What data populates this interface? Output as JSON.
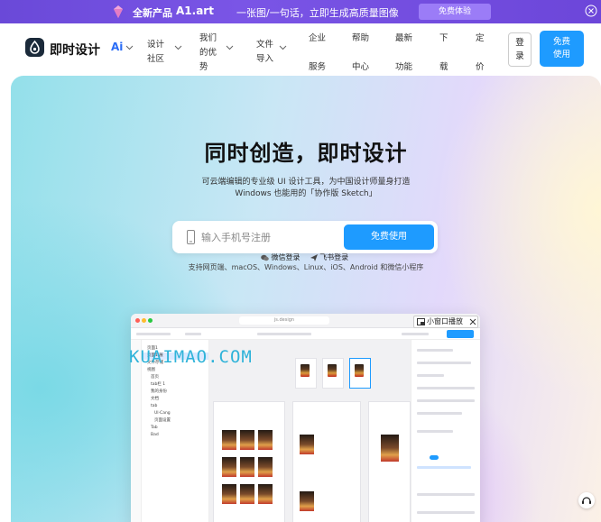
{
  "promo": {
    "label_new": "全新产品",
    "product": "A1.art",
    "tagline": "一张图/一句话，立即生成高质量图像",
    "cta": "免费体验",
    "icon": "gem-icon",
    "close_icon": "close-icon"
  },
  "nav": {
    "brand": "即时设计",
    "ai": "Ai",
    "items": [
      {
        "label": "设计\n社区",
        "has_dropdown": true
      },
      {
        "label": "我们\n的优\n势",
        "has_dropdown": true
      },
      {
        "label": "文件\n导入",
        "has_dropdown": true
      },
      {
        "label": "企业\n\n服务"
      },
      {
        "label": "帮助\n\n中心"
      },
      {
        "label": "最新\n\n功能"
      },
      {
        "label": "下\n\n载"
      },
      {
        "label": "定\n\n价"
      }
    ],
    "login": "登\n录",
    "signup": "免费\n使用"
  },
  "hero": {
    "title": "同时创造，即时设计",
    "subtitle_line1": "可云端编辑的专业级 UI 设计工具，为中国设计师量身打造",
    "subtitle_line2": "Windows 也能用的「协作版 Sketch」",
    "phone_placeholder": "输入手机号注册",
    "free_button": "免费使用",
    "wechat_login": "微信登录",
    "feishu_login": "飞书登录",
    "platforms": "支持网页端、macOS、Windows、Linux、iOS、Android 和微信小程序"
  },
  "preview": {
    "url": "js.design",
    "small_window": "小窗口播放",
    "layers": [
      "页面1",
      "页面1·展",
      "文件存储",
      "视图",
      "首页",
      "tab栏 1",
      "我的身份",
      "文档",
      "tab",
      "UI·Cang",
      "页面设置",
      "Tab",
      "Bad"
    ],
    "watermark": "KUAIMAO.COM"
  },
  "colors": {
    "accent": "#1e9bff",
    "promo_bg": "#6a49d8",
    "brand_dark": "#1b2a3a"
  }
}
